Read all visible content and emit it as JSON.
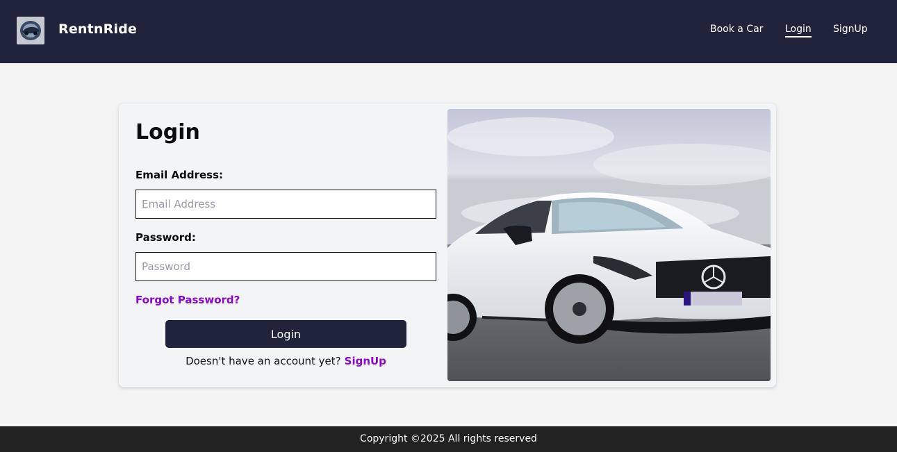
{
  "navbar": {
    "brand_name": "RentnRide",
    "links": [
      {
        "label": "Book a Car",
        "active": false
      },
      {
        "label": "Login",
        "active": true
      },
      {
        "label": "SignUp",
        "active": false
      }
    ]
  },
  "login_form": {
    "title": "Login",
    "email_label": "Email Address:",
    "email_placeholder": "Email Address",
    "email_value": "",
    "password_label": "Password:",
    "password_placeholder": "Password",
    "password_value": "",
    "forgot_password": "Forgot Password?",
    "submit_label": "Login",
    "signup_prompt": "Doesn't have an account yet?",
    "signup_link": "SignUp"
  },
  "hero_image": {
    "subject": "white-coupe-car-photo"
  },
  "footer": {
    "copyright": "Copyright ©2025 All rights reserved"
  },
  "colors": {
    "navbar_bg": "#20243a",
    "accent_link": "#8a08c9",
    "footer_bg": "#222222",
    "page_bg": "#f4f4f5"
  }
}
